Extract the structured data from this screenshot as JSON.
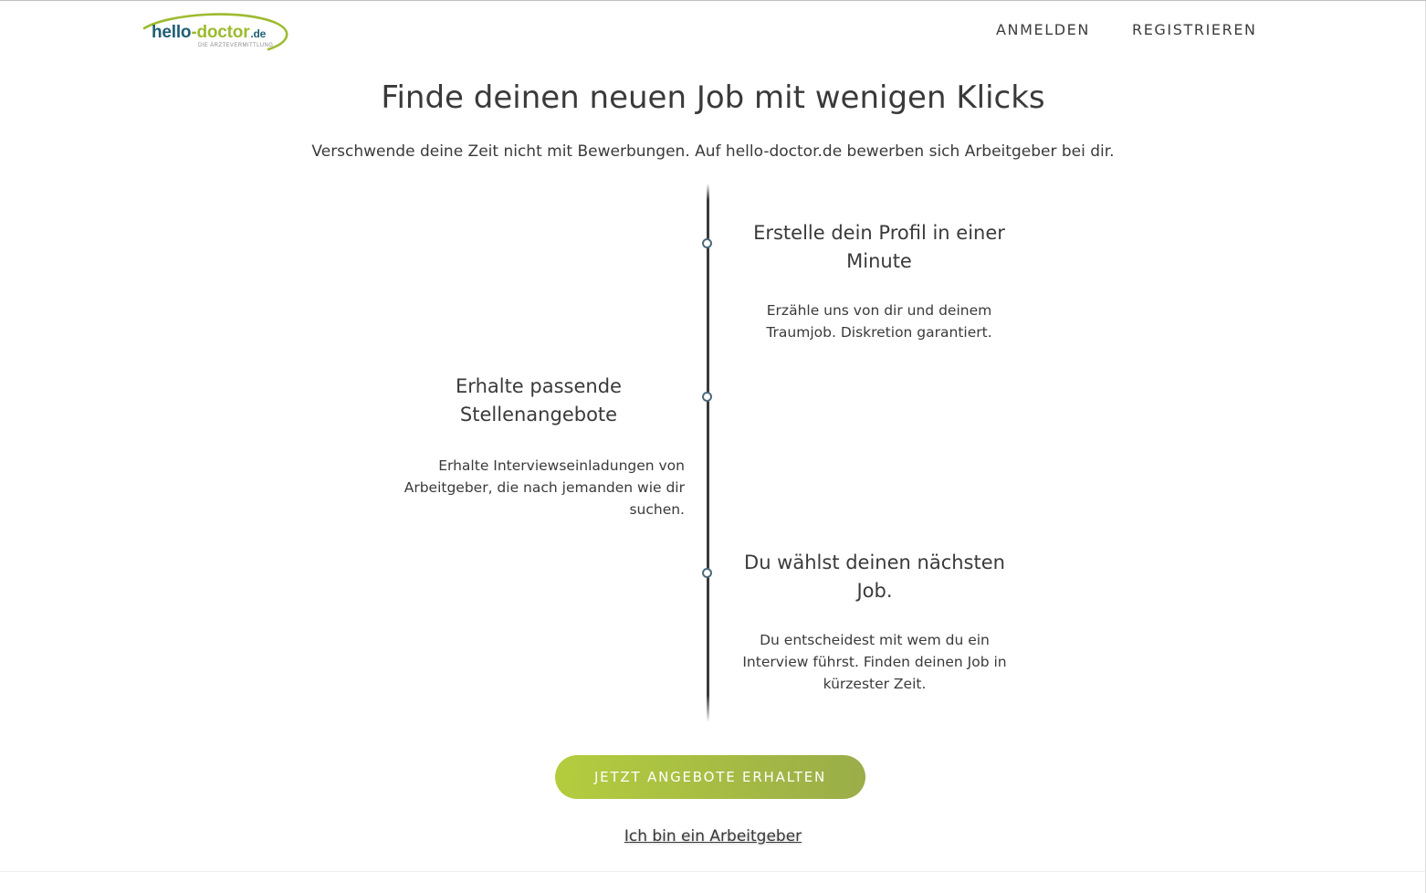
{
  "header": {
    "logo": {
      "name": "hello",
      "dash": "-",
      "brand": "doctor",
      "tld": ".de",
      "tagline": "DIE ÄRZTEVERMITTLUNG"
    },
    "nav": {
      "login": "ANMELDEN",
      "register": "REGISTRIEREN"
    }
  },
  "hero": {
    "title": "Finde deinen neuen Job mit wenigen Klicks",
    "subtitle": "Verschwende deine Zeit nicht mit Bewerbungen. Auf hello-doctor.de bewerben sich Arbeitgeber bei dir."
  },
  "steps": [
    {
      "title": "Erstelle dein Profil in einer Minute",
      "text": "Erzähle uns von dir und deinem Traumjob. Diskretion garantiert."
    },
    {
      "title": "Erhalte passende Stellenangebote",
      "text": "Erhalte Interviewseinladungen von Arbeitgeber, die nach jemanden wie dir suchen."
    },
    {
      "title": "Du wählst deinen nächsten Job.",
      "text": "Du entscheidest mit wem du ein Interview führst. Finden deinen Job in kürzester Zeit."
    }
  ],
  "cta": {
    "button_label": "JETZT ANGEBOTE ERHALTEN",
    "employer_link": "Ich bin ein Arbeitgeber"
  },
  "colors": {
    "brand_blue": "#1f5e74",
    "brand_green": "#9cbb2f",
    "button_gradient_start": "#b3cd3e",
    "button_gradient_end": "#9aad49",
    "timeline_dot": "#4e6b7a",
    "text": "#3a3a3a"
  }
}
